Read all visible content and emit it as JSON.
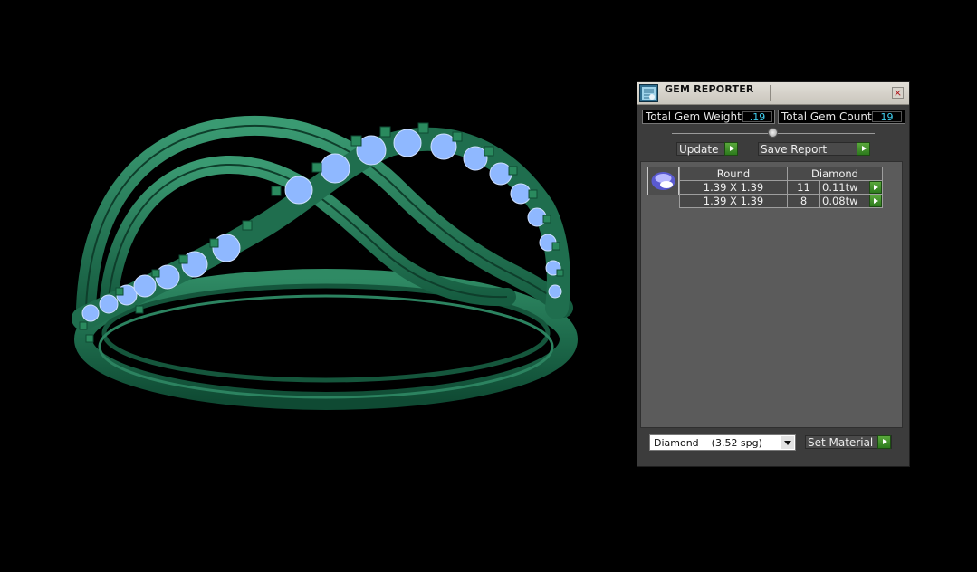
{
  "viewport": {
    "model": "ring-3d-model"
  },
  "panel": {
    "title": "GEM REPORTER",
    "close_label": "×",
    "total_weight_label": "Total Gem Weight",
    "total_weight_value": ".19",
    "total_count_label": "Total Gem Count",
    "total_count_value": "19",
    "update_label": "Update",
    "save_report_label": "Save Report",
    "table": {
      "headers": [
        "Round",
        "Diamond"
      ],
      "rows": [
        {
          "size": "1.39 X 1.39",
          "count": "11",
          "weight": "0.11tw"
        },
        {
          "size": "1.39 X 1.39",
          "count": "8",
          "weight": "0.08tw"
        }
      ]
    },
    "material_selected": "Diamond    (3.52 spg)",
    "set_material_label": "Set Material",
    "colors": {
      "accent_green": "#3e9a2a",
      "value_cyan": "#3fd0f0",
      "metal": "#1f6b4e",
      "gem": "#8fb8ff"
    },
    "icons": [
      "gem-reporter-icon",
      "close-icon",
      "play-arrow-icon",
      "gem-thumbnail-icon",
      "dropdown-arrow-icon"
    ]
  }
}
